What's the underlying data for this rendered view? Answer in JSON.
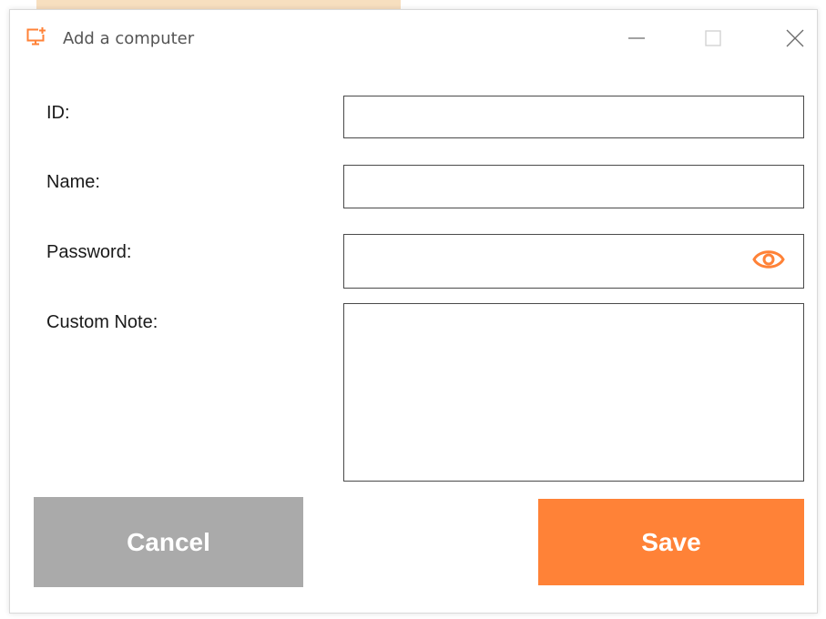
{
  "window": {
    "title": "Add a computer"
  },
  "form": {
    "id_label": "ID:",
    "id_value": "",
    "name_label": "Name:",
    "name_value": "",
    "password_label": "Password:",
    "password_value": "",
    "note_label": "Custom Note:",
    "note_value": ""
  },
  "buttons": {
    "cancel_label": "Cancel",
    "save_label": "Save"
  },
  "icons": {
    "app": "add-computer-icon",
    "minimize": "minimize-icon",
    "maximize": "maximize-icon",
    "close": "close-icon",
    "show_password": "eye-icon"
  },
  "colors": {
    "accent": "#ff8237",
    "cancel": "#aaaaaa"
  }
}
